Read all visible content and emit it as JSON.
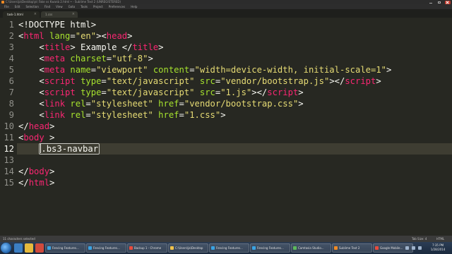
{
  "window": {
    "title": "C:\\Users\\ja\\Desktop\\js\\ Fake vs Kwanb 2.html • - Sublime Text 2 (UNREGISTERED)"
  },
  "menu": [
    "File",
    "Edit",
    "Selection",
    "Find",
    "View",
    "Goto",
    "Tools",
    "Project",
    "Preferences",
    "Help"
  ],
  "tabs": [
    {
      "label": "task-1.html",
      "active": true
    },
    {
      "label": "1.css",
      "active": false
    }
  ],
  "editor": {
    "current_line": 12,
    "lines": [
      {
        "n": "1",
        "segments": [
          {
            "text": "<!DOCTYPE html>",
            "cls": "ptext"
          }
        ]
      },
      {
        "n": "2",
        "segments": [
          {
            "text": "<",
            "cls": "ptext"
          },
          {
            "text": "html",
            "cls": "tag"
          },
          {
            "text": " ",
            "cls": "ptext"
          },
          {
            "text": "lang",
            "cls": "attr"
          },
          {
            "text": "=",
            "cls": "ptext"
          },
          {
            "text": "\"en\"",
            "cls": "str"
          },
          {
            "text": "><",
            "cls": "ptext"
          },
          {
            "text": "head",
            "cls": "tag"
          },
          {
            "text": ">",
            "cls": "ptext"
          }
        ]
      },
      {
        "n": "3",
        "segments": [
          {
            "text": "    <",
            "cls": "ptext"
          },
          {
            "text": "title",
            "cls": "tag"
          },
          {
            "text": "> Example </",
            "cls": "ptext"
          },
          {
            "text": "title",
            "cls": "tag"
          },
          {
            "text": ">",
            "cls": "ptext"
          }
        ]
      },
      {
        "n": "4",
        "segments": [
          {
            "text": "    <",
            "cls": "ptext"
          },
          {
            "text": "meta",
            "cls": "tag"
          },
          {
            "text": " ",
            "cls": "ptext"
          },
          {
            "text": "charset",
            "cls": "attr"
          },
          {
            "text": "=",
            "cls": "ptext"
          },
          {
            "text": "\"utf-8\"",
            "cls": "str"
          },
          {
            "text": ">",
            "cls": "ptext"
          }
        ]
      },
      {
        "n": "5",
        "segments": [
          {
            "text": "    <",
            "cls": "ptext"
          },
          {
            "text": "meta",
            "cls": "tag"
          },
          {
            "text": " ",
            "cls": "ptext"
          },
          {
            "text": "name",
            "cls": "attr"
          },
          {
            "text": "=",
            "cls": "ptext"
          },
          {
            "text": "\"viewport\"",
            "cls": "str"
          },
          {
            "text": " ",
            "cls": "ptext"
          },
          {
            "text": "content",
            "cls": "attr"
          },
          {
            "text": "=",
            "cls": "ptext"
          },
          {
            "text": "\"width=device-width, initial-scale=1\"",
            "cls": "str"
          },
          {
            "text": ">",
            "cls": "ptext"
          }
        ]
      },
      {
        "n": "6",
        "segments": [
          {
            "text": "    <",
            "cls": "ptext"
          },
          {
            "text": "script",
            "cls": "tag"
          },
          {
            "text": " ",
            "cls": "ptext"
          },
          {
            "text": "type",
            "cls": "attr"
          },
          {
            "text": "=",
            "cls": "ptext"
          },
          {
            "text": "\"text/javascript\"",
            "cls": "str"
          },
          {
            "text": " ",
            "cls": "ptext"
          },
          {
            "text": "src",
            "cls": "attr"
          },
          {
            "text": "=",
            "cls": "ptext"
          },
          {
            "text": "\"vendor/bootstrap.js\"",
            "cls": "str"
          },
          {
            "text": "></",
            "cls": "ptext"
          },
          {
            "text": "script",
            "cls": "tag"
          },
          {
            "text": ">",
            "cls": "ptext"
          }
        ]
      },
      {
        "n": "7",
        "segments": [
          {
            "text": "    <",
            "cls": "ptext"
          },
          {
            "text": "script",
            "cls": "tag"
          },
          {
            "text": " ",
            "cls": "ptext"
          },
          {
            "text": "type",
            "cls": "attr"
          },
          {
            "text": "=",
            "cls": "ptext"
          },
          {
            "text": "\"text/javascript\"",
            "cls": "str"
          },
          {
            "text": " ",
            "cls": "ptext"
          },
          {
            "text": "src",
            "cls": "attr"
          },
          {
            "text": "=",
            "cls": "ptext"
          },
          {
            "text": "\"1.js\"",
            "cls": "str"
          },
          {
            "text": "></",
            "cls": "ptext"
          },
          {
            "text": "script",
            "cls": "tag"
          },
          {
            "text": ">",
            "cls": "ptext"
          }
        ]
      },
      {
        "n": "8",
        "segments": [
          {
            "text": "    <",
            "cls": "ptext"
          },
          {
            "text": "link",
            "cls": "tag"
          },
          {
            "text": " ",
            "cls": "ptext"
          },
          {
            "text": "rel",
            "cls": "attr"
          },
          {
            "text": "=",
            "cls": "ptext"
          },
          {
            "text": "\"stylesheet\"",
            "cls": "str"
          },
          {
            "text": " ",
            "cls": "ptext"
          },
          {
            "text": "href",
            "cls": "attr"
          },
          {
            "text": "=",
            "cls": "ptext"
          },
          {
            "text": "\"vendor/bootstrap.css\"",
            "cls": "str"
          },
          {
            "text": ">",
            "cls": "ptext"
          }
        ]
      },
      {
        "n": "9",
        "segments": [
          {
            "text": "    <",
            "cls": "ptext"
          },
          {
            "text": "link",
            "cls": "tag"
          },
          {
            "text": " ",
            "cls": "ptext"
          },
          {
            "text": "rel",
            "cls": "attr"
          },
          {
            "text": "=",
            "cls": "ptext"
          },
          {
            "text": "\"stylesheet\"",
            "cls": "str"
          },
          {
            "text": " ",
            "cls": "ptext"
          },
          {
            "text": "href",
            "cls": "attr"
          },
          {
            "text": "=",
            "cls": "ptext"
          },
          {
            "text": "\"1.css\"",
            "cls": "str"
          },
          {
            "text": ">",
            "cls": "ptext"
          }
        ]
      },
      {
        "n": "10",
        "segments": [
          {
            "text": "</",
            "cls": "ptext"
          },
          {
            "text": "head",
            "cls": "tag"
          },
          {
            "text": ">",
            "cls": "ptext"
          }
        ]
      },
      {
        "n": "11",
        "segments": [
          {
            "text": "<",
            "cls": "ptext"
          },
          {
            "text": "body",
            "cls": "tag"
          },
          {
            "text": " >",
            "cls": "ptext"
          }
        ]
      },
      {
        "n": "12",
        "indent": "    ",
        "abbr": ".bs3-navbar",
        "segments": []
      },
      {
        "n": "13",
        "segments": []
      },
      {
        "n": "14",
        "segments": [
          {
            "text": "</",
            "cls": "ptext"
          },
          {
            "text": "body",
            "cls": "tag"
          },
          {
            "text": ">",
            "cls": "ptext"
          }
        ]
      },
      {
        "n": "15",
        "segments": [
          {
            "text": "</",
            "cls": "ptext"
          },
          {
            "text": "html",
            "cls": "tag"
          },
          {
            "text": ">",
            "cls": "ptext"
          }
        ]
      }
    ]
  },
  "status": {
    "left": "11 characters selected",
    "tab_size": "Tab Size: 4",
    "syntax": "HTML"
  },
  "taskbar": {
    "items": [
      {
        "label": "Fencing Features...",
        "color": "#3aa3e3"
      },
      {
        "label": "Fencing Features...",
        "color": "#3aa3e3"
      },
      {
        "label": "Backup 1 - Chrome",
        "color": "#e94b3c"
      },
      {
        "label": "C:\\Users\\ja\\Desktop",
        "color": "#f0c24b"
      },
      {
        "label": "Fencing Features...",
        "color": "#3aa3e3"
      },
      {
        "label": "Fencing Features...",
        "color": "#3aa3e3"
      },
      {
        "label": "Camtasia Studio...",
        "color": "#5cb85c"
      },
      {
        "label": "Sublime Text 2",
        "color": "#f08a24"
      },
      {
        "label": "Google Mobile...",
        "color": "#e94b3c"
      }
    ],
    "clock_time": "7:35 PM",
    "clock_date": "1/28/2014"
  },
  "colors": {
    "background": "#272822",
    "tag": "#f92672",
    "attribute": "#a6e22e",
    "string": "#e6db74",
    "text": "#f8f8f2",
    "line_number": "#90908a"
  }
}
